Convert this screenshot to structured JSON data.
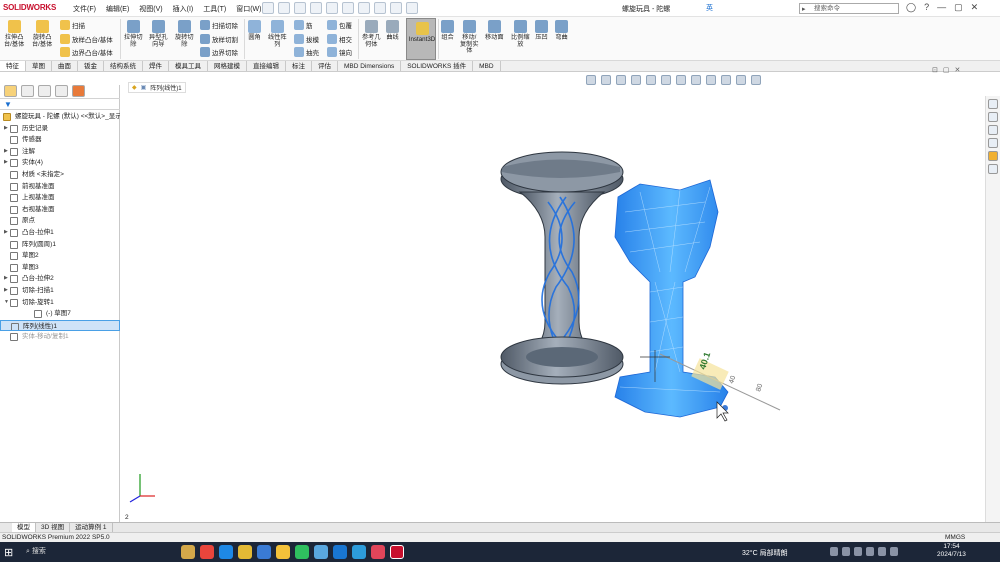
{
  "app": {
    "brand": "SOLIDWORKS",
    "doc_title": "螺旋玩具 - 陀螺",
    "search_placeholder": "搜索命令",
    "status_left": "SOLIDWORKS Premium 2022 SP5.0",
    "units": "MMGS"
  },
  "menus": [
    "文件(F)",
    "编辑(E)",
    "视图(V)",
    "插入(I)",
    "工具(T)",
    "窗口(W)"
  ],
  "ribbon": {
    "extrude_boss": "拉伸凸\n台/基体",
    "revolve_boss": "旋转凸\n台/基体",
    "sweep": "扫描",
    "loft": "放样凸台/基体",
    "boundary": "边界凸台/基体",
    "extrude_cut": "拉伸切\n除",
    "hole_wizard": "异型孔\n向导",
    "revolve_cut": "旋转切\n除",
    "swept_cut": "扫描切除",
    "lofted_cut": "放样切割",
    "boundary_cut": "边界切除",
    "fillet": "圆角",
    "linear_pattern": "线性阵\n列",
    "rib": "筋",
    "draft": "拔模",
    "shell": "抽壳",
    "wrap": "包覆",
    "intersect": "相交",
    "mirror": "镜向",
    "ref_geometry": "参考几\n何体",
    "curves": "曲线",
    "instant3d": "Instant3D",
    "combine": "组合",
    "move_copy": "移动/\n复制实\n体",
    "move_face": "移动面",
    "scale": "比例缩\n放",
    "indent": "压凹",
    "flex": "弯曲"
  },
  "tabs": [
    "特征",
    "草图",
    "曲面",
    "钣金",
    "结构系统",
    "焊件",
    "模具工具",
    "网格建模",
    "直接编辑",
    "标注",
    "评估",
    "MBD Dimensions",
    "SOLIDWORKS 插件",
    "MBD"
  ],
  "tree": [
    {
      "label": "螺旋玩具 - 陀螺 (默认) <<默认>_显示",
      "arrow": ""
    },
    {
      "label": "历史记录",
      "arrow": "▶"
    },
    {
      "label": "传感器",
      "arrow": ""
    },
    {
      "label": "注解",
      "arrow": "▶"
    },
    {
      "label": "实体(4)",
      "arrow": "▶"
    },
    {
      "label": "材质 <未指定>",
      "arrow": ""
    },
    {
      "label": "前视基准面",
      "arrow": ""
    },
    {
      "label": "上视基准面",
      "arrow": ""
    },
    {
      "label": "右视基准面",
      "arrow": ""
    },
    {
      "label": "原点",
      "arrow": ""
    },
    {
      "label": "凸台-拉伸1",
      "arrow": "▶"
    },
    {
      "label": "阵列(圆周)1",
      "arrow": ""
    },
    {
      "label": "草图2",
      "arrow": ""
    },
    {
      "label": "草图3",
      "arrow": ""
    },
    {
      "label": "凸台-拉伸2",
      "arrow": "▶"
    },
    {
      "label": "切除-扫描1",
      "arrow": "▶"
    },
    {
      "label": "切除-旋转1",
      "arrow": "▼"
    },
    {
      "label": "(-) 草图7",
      "arrow": ""
    },
    {
      "label": "阵列(线性)1",
      "arrow": ""
    },
    {
      "label": "实体-移动/复制1",
      "arrow": ""
    }
  ],
  "breadcrumb": "阵列(线性)1",
  "dimension_value": "40.1",
  "ruler_marks": [
    "40",
    "80"
  ],
  "triad_label": "2",
  "bottom_tabs": [
    "模型",
    "3D 视图",
    "运动算例 1"
  ],
  "taskbar": {
    "search": "搜索",
    "weather": "32°C 局部晴朗",
    "time": "17:54",
    "date": "2024/7/13",
    "ime": "英"
  },
  "colors": {
    "accent": "#1a6fd0",
    "ghost_blue": "#1e90ff",
    "model_grey": "#6b7785",
    "taskbar": "#1c2638"
  }
}
